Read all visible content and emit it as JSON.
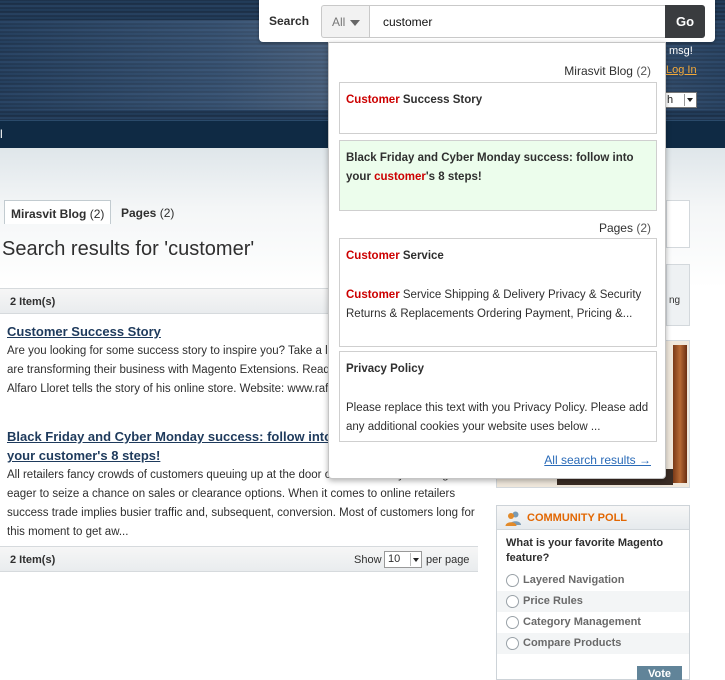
{
  "header": {
    "msg_fragment": "msg!",
    "login_fragment": "Log In",
    "select_fragment": "h",
    "nav_fragment": "l"
  },
  "search": {
    "label": "Search",
    "category": "All",
    "query": "customer",
    "go_label": "Go"
  },
  "autocomplete": {
    "groups": [
      {
        "name": "Mirasvit Blog",
        "count": "(2)",
        "items": [
          {
            "title_highlight": "Customer",
            "title_rest": " Success Story"
          },
          {
            "title_pre": "Black Friday and Cyber Monday success: follow into your ",
            "title_highlight": "customer",
            "title_rest": "'s 8 steps!"
          }
        ]
      },
      {
        "name": "Pages",
        "count": "(2)",
        "items": [
          {
            "title_highlight": "Customer",
            "title_rest": " Service",
            "body_highlight": "Customer",
            "body_rest": " Service Shipping & Delivery Privacy & Security Returns & Replacements Ordering Payment, Pricing &..."
          },
          {
            "title": "Privacy Policy",
            "body": "Please replace this text with you Privacy Policy. Please add any additional cookies your website uses below ..."
          }
        ]
      }
    ],
    "all_results": "All search results →"
  },
  "tabs": [
    {
      "label": "Mirasvit Blog",
      "count": "(2)"
    },
    {
      "label": "Pages",
      "count": "(2)"
    }
  ],
  "results_title": "Search results for 'customer'",
  "toolbar": {
    "items_count": "2 Item(s)",
    "show_label": "Show",
    "limit": "10",
    "per_page": "per page"
  },
  "results": [
    {
      "title": "Customer Success Story",
      "description": "  Are you looking for some success story to inspire you? Take a look at how our customers are transforming their business with Magento Extensions. Read on to find out how. Sergio Alfaro Lloret tells the story of his online store. Website: www.rafasshop.info..."
    },
    {
      "title": "Black Friday and Cyber Monday success: follow into your customer's 8 steps!",
      "description": "All retailers fancy crowds of customers queuing up at the door on Black Friday morning eager to seize a chance on sales or clearance options. When it comes to online retailers success trade implies busier traffic and, subsequent, conversion. Most of customers long for this moment to get aw..."
    }
  ],
  "sidebar": {
    "peek_text": "ng"
  },
  "poll": {
    "title": "COMMUNITY POLL",
    "question": "What is your favorite Magento feature?",
    "options": [
      "Layered Navigation",
      "Price Rules",
      "Category Management",
      "Compare Products"
    ],
    "vote_label": "Vote"
  },
  "colors": {
    "highlight": "#cc0000",
    "link": "#2a6bb8",
    "poll_title": "#e26703",
    "nav": "#0f2a44"
  }
}
